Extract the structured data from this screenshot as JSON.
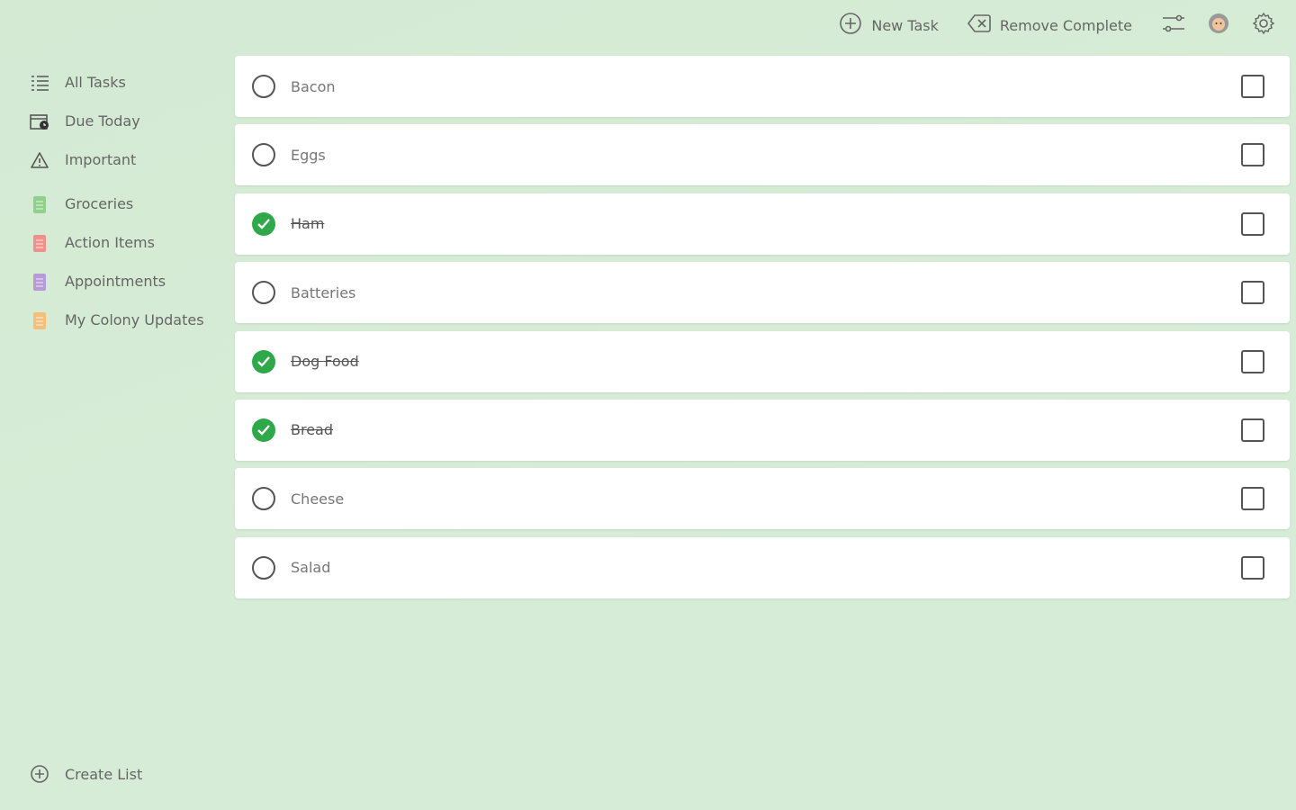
{
  "toolbar": {
    "new_task_label": "New Task",
    "remove_complete_label": "Remove Complete"
  },
  "sidebar": {
    "items": [
      {
        "label": "All Tasks",
        "icon": "list-icon"
      },
      {
        "label": "Due Today",
        "icon": "calendar-clock-icon"
      },
      {
        "label": "Important",
        "icon": "warning-icon"
      }
    ],
    "lists": [
      {
        "label": "Groceries",
        "icon": "notepad-icon",
        "color": "#8fd18c"
      },
      {
        "label": "Action Items",
        "icon": "notepad-icon",
        "color": "#f0908a"
      },
      {
        "label": "Appointments",
        "icon": "notepad-icon",
        "color": "#b99ad8"
      },
      {
        "label": "My Colony Updates",
        "icon": "notepad-icon",
        "color": "#f3bf7a"
      }
    ],
    "create_list_label": "Create List"
  },
  "tasks": [
    {
      "label": "Bacon",
      "done": false
    },
    {
      "label": "Eggs",
      "done": false
    },
    {
      "label": "Ham",
      "done": true
    },
    {
      "label": "Batteries",
      "done": false
    },
    {
      "label": "Dog Food",
      "done": true
    },
    {
      "label": "Bread",
      "done": true
    },
    {
      "label": "Cheese",
      "done": false
    },
    {
      "label": "Salad",
      "done": false
    }
  ],
  "colors": {
    "accent_green": "#2fa84a",
    "background": "#d5ebd4"
  }
}
